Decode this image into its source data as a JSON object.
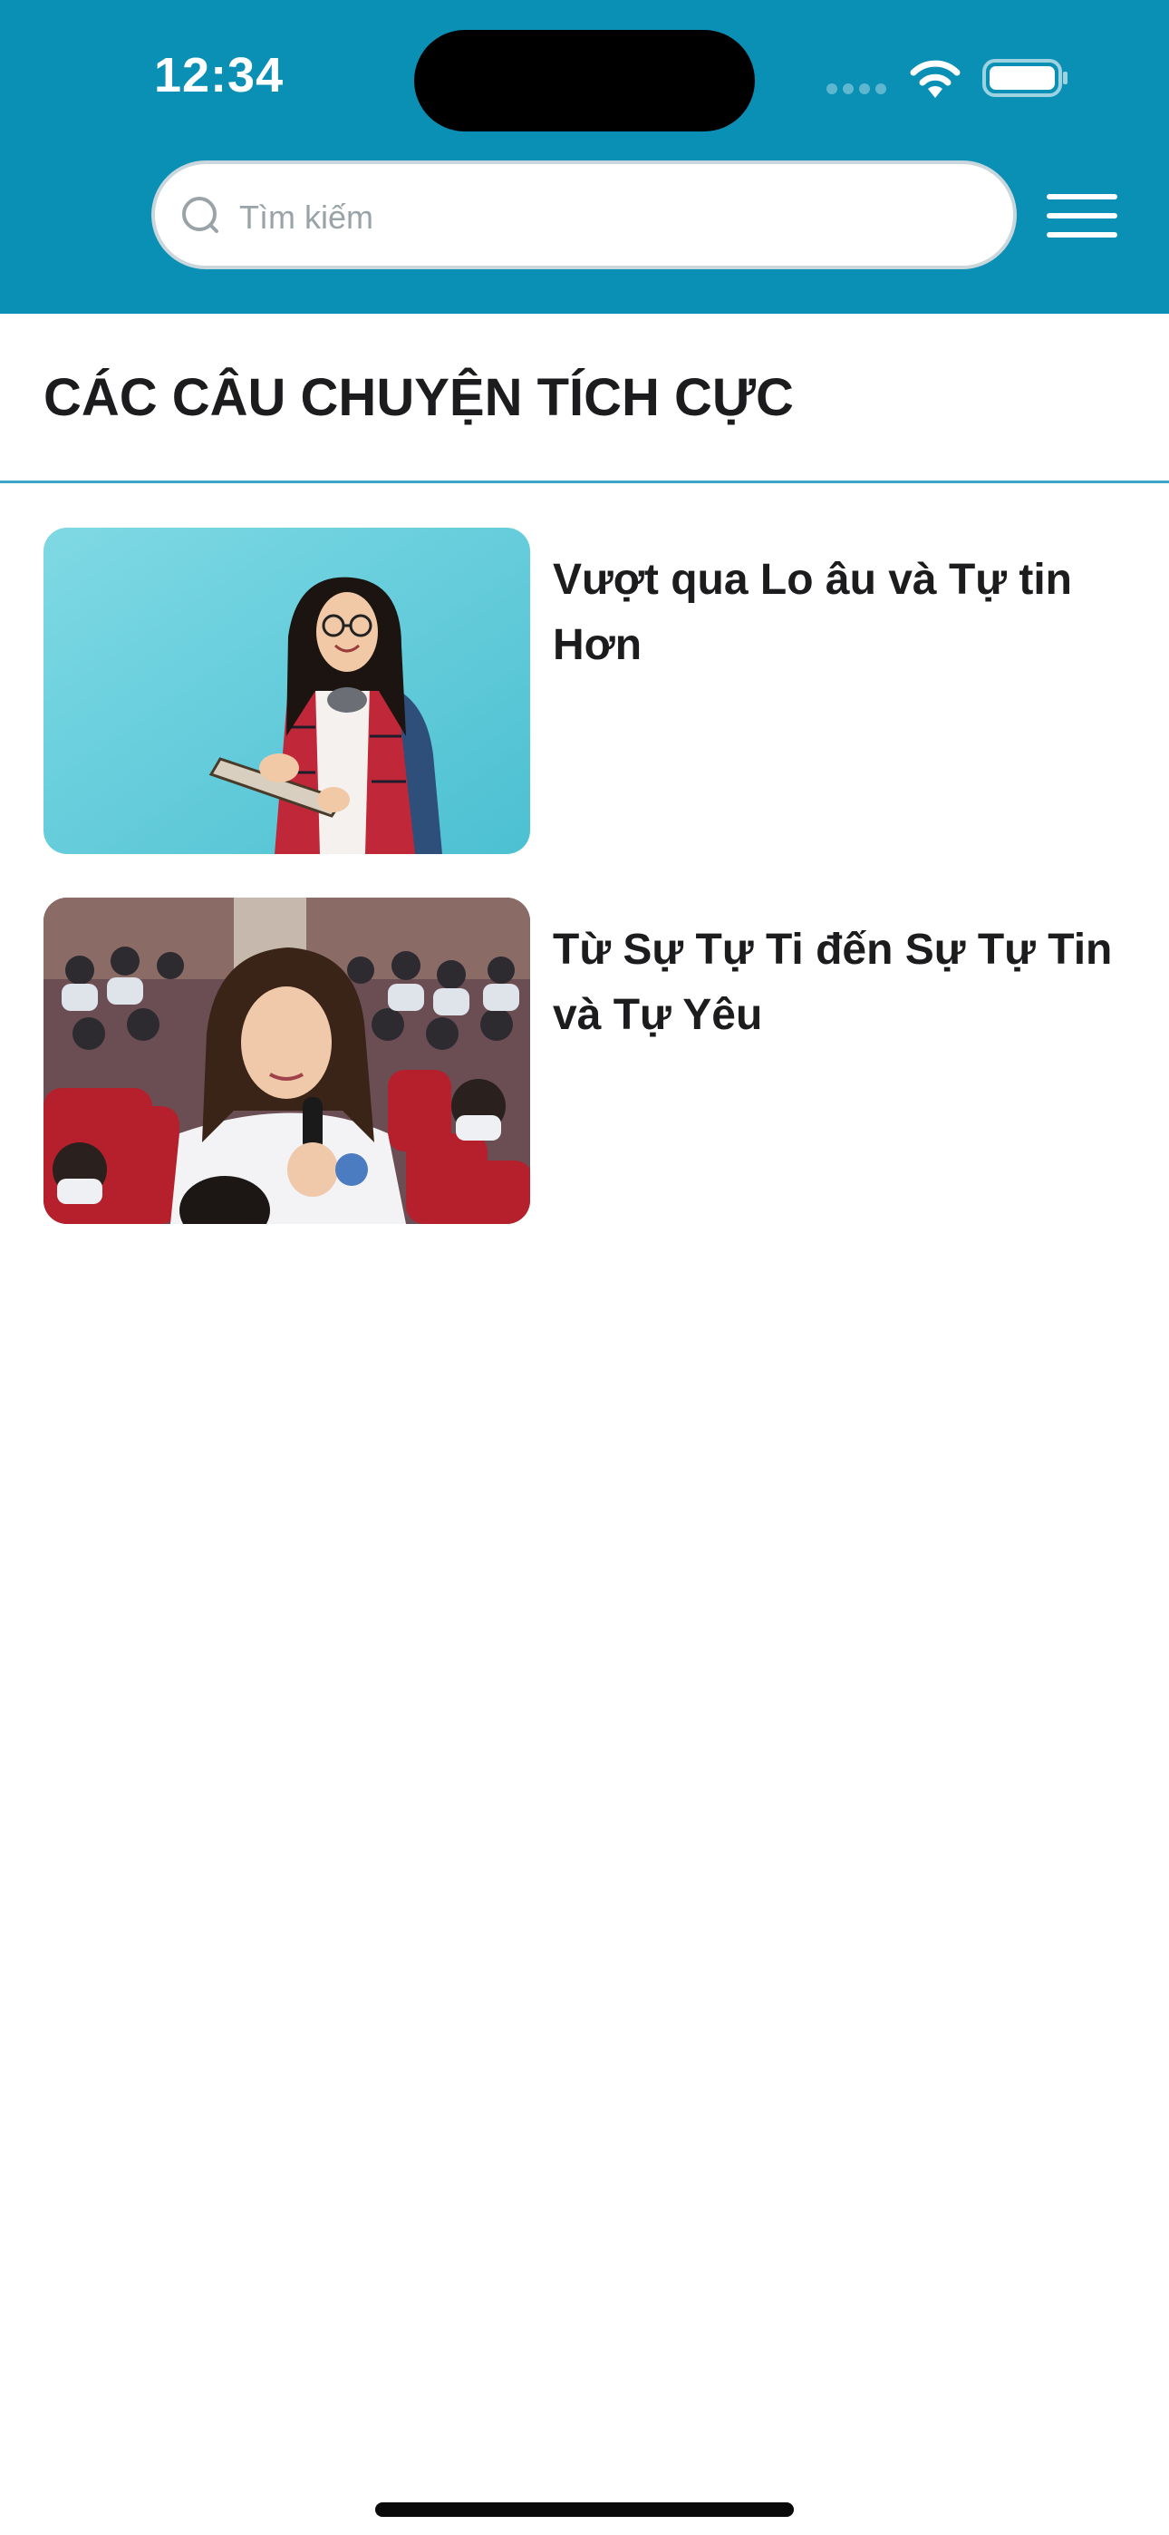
{
  "status_bar": {
    "time": "12:34"
  },
  "header": {
    "background_color": "#0a8fb5",
    "search": {
      "placeholder": "Tìm kiếm",
      "icon": "search-icon"
    },
    "menu_icon": "hamburger-menu-icon"
  },
  "page": {
    "title": "CÁC CÂU CHUYỆN TÍCH CỰC"
  },
  "stories": [
    {
      "title": "Vượt qua Lo âu và Tự tin Hơn",
      "image": "student-with-backpack-and-book-photo"
    },
    {
      "title": "Từ Sự Tự Ti đến Sự Tự Tin và Tự Yêu",
      "image": "student-speaking-with-microphone-photo"
    }
  ]
}
